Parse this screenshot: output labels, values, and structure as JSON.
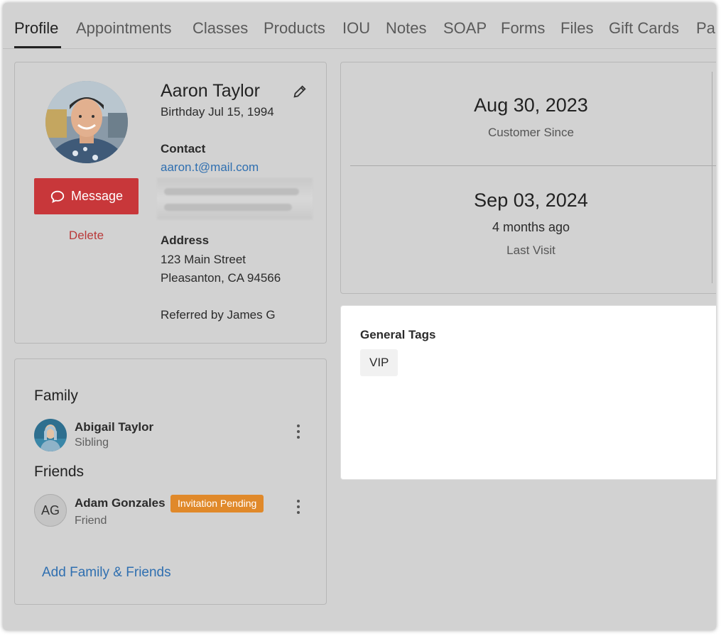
{
  "tabs": [
    {
      "label": "Profile",
      "active": true
    },
    {
      "label": "Appointments"
    },
    {
      "label": "Classes"
    },
    {
      "label": "Products"
    },
    {
      "label": "IOU"
    },
    {
      "label": "Notes"
    },
    {
      "label": "SOAP"
    },
    {
      "label": "Forms"
    },
    {
      "label": "Files"
    },
    {
      "label": "Gift Cards"
    },
    {
      "label": "Pa"
    }
  ],
  "profile": {
    "name": "Aaron Taylor",
    "birthday": "Birthday Jul 15, 1994",
    "contact_label": "Contact",
    "email": "aaron.t@mail.com",
    "address_label": "Address",
    "address_line1": "123 Main Street",
    "address_line2": "Pleasanton, CA 94566",
    "referred_by": "Referred by James G",
    "message_label": "Message",
    "delete_label": "Delete",
    "icons": {
      "edit": "pencil-icon",
      "message": "chat-bubble-icon"
    },
    "accent_color": "#c8373a"
  },
  "dates": {
    "customer_since_date": "Aug 30, 2023",
    "customer_since_label": "Customer Since",
    "last_visit_date": "Sep 03, 2024",
    "last_visit_relative": "4 months ago",
    "last_visit_label": "Last Visit"
  },
  "tags": {
    "title": "General Tags",
    "items": [
      "VIP"
    ]
  },
  "relations": {
    "family_title": "Family",
    "family": [
      {
        "name": "Abigail Taylor",
        "relation": "Sibling"
      }
    ],
    "friends_title": "Friends",
    "friends": [
      {
        "initials": "AG",
        "name": "Adam Gonzales",
        "relation": "Friend",
        "badge": "Invitation Pending"
      }
    ],
    "add_label": "Add Family & Friends",
    "badge_color": "#e0892a",
    "link_color": "#2f6fb0"
  }
}
